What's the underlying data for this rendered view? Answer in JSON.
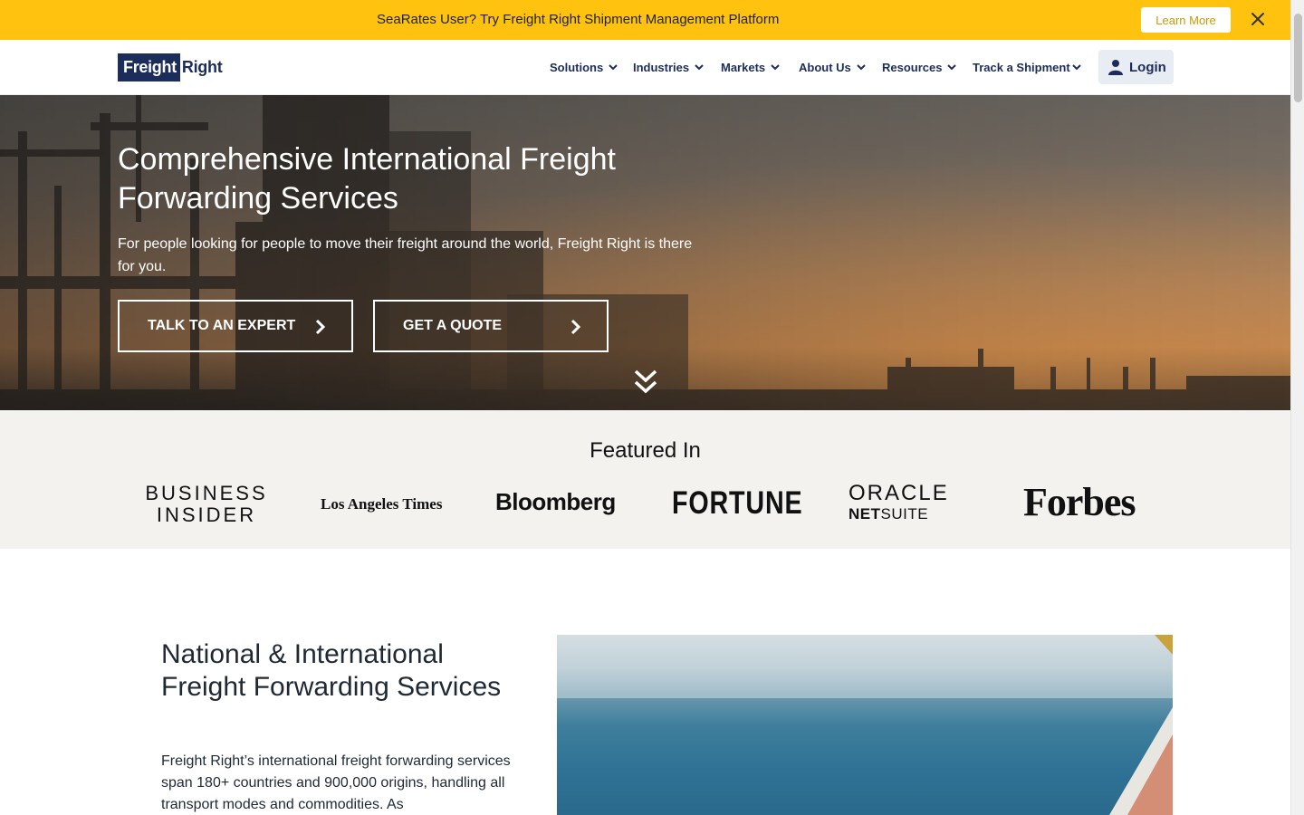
{
  "announcement": {
    "text": "SeaRates User? Try Freight Right Shipment Management Platform",
    "button_label": "Learn More"
  },
  "header": {
    "logo_part1": "Freight",
    "logo_part2": "Right",
    "nav": [
      {
        "label": "Solutions"
      },
      {
        "label": "Industries"
      },
      {
        "label": "Markets"
      },
      {
        "label": "About Us"
      },
      {
        "label": "Resources"
      },
      {
        "label": "Track a Shipment"
      }
    ],
    "login_label": "Login"
  },
  "hero": {
    "title": "Comprehensive International Freight Forwarding Services",
    "subtitle": "For people looking for people to move their freight around the world, Freight Right is there for you.",
    "cta_expert": "TALK TO AN EXPERT",
    "cta_quote": "GET A QUOTE"
  },
  "featured": {
    "title": "Featured In",
    "logos": {
      "business_insider_line1": "BUSINESS",
      "business_insider_line2": "INSIDER",
      "la_times": "Los Angeles Times",
      "bloomberg": "Bloomberg",
      "fortune": "FORTUNE",
      "oracle": "ORACLE",
      "netsuite_a": "NET",
      "netsuite_b": "SUITE",
      "forbes": "Forbes"
    }
  },
  "section": {
    "title": "National & International Freight Forwarding Services",
    "body": "Freight Right’s international freight forwarding services span 180+ countries and 900,000 origins, handling all transport modes and commodities. As"
  },
  "colors": {
    "announcement_bg": "#ffc20e",
    "brand_navy": "#1c2d5a",
    "featured_bg": "#f3f2ef"
  }
}
